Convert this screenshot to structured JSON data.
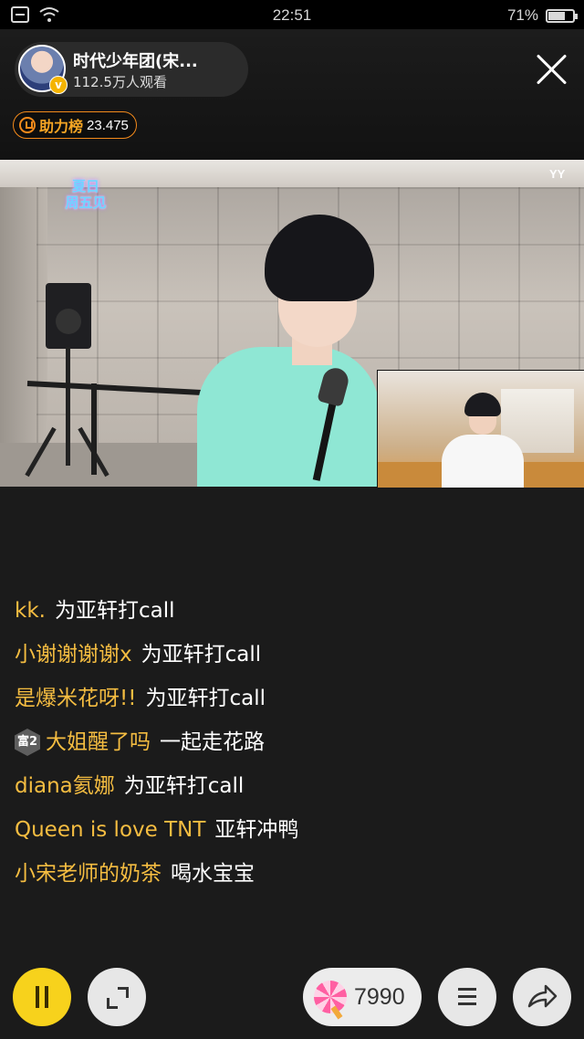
{
  "status_bar": {
    "time": "22:51",
    "battery_percent": "71%",
    "battery_level": 0.71,
    "icons": [
      "notification-icon",
      "wifi-icon"
    ]
  },
  "host": {
    "name": "时代少年团(宋...",
    "viewers": "112.5万人观看",
    "verified_badge": "v",
    "close_icon": "close-icon"
  },
  "rank": {
    "label": "助力榜",
    "value": "23.475"
  },
  "video": {
    "watermark": "YY",
    "logo_text_line1": "夏日",
    "logo_text_line2": "周五见"
  },
  "chat": [
    {
      "user": "kk.",
      "message": "为亚轩打call",
      "level": null
    },
    {
      "user": "小谢谢谢谢x",
      "message": "为亚轩打call",
      "level": null
    },
    {
      "user": "是爆米花呀!!",
      "message": "为亚轩打call",
      "level": null
    },
    {
      "user": "大姐醒了吗",
      "message": "一起走花路",
      "level": "富2"
    },
    {
      "user": "diana氦娜",
      "message": "为亚轩打call",
      "level": null
    },
    {
      "user": "Queen is love TNT",
      "message": "亚轩冲鸭",
      "level": null
    },
    {
      "user": "小宋老师的奶茶",
      "message": "喝水宝宝",
      "level": null
    }
  ],
  "bottom": {
    "gift_count": "7990",
    "icons": [
      "pause-icon",
      "expand-icon",
      "lollipop-icon",
      "menu-icon",
      "share-icon"
    ]
  },
  "colors": {
    "username": "#f5bd41",
    "pause_button": "#f7d21c",
    "rank_border": "#f38a1b"
  }
}
